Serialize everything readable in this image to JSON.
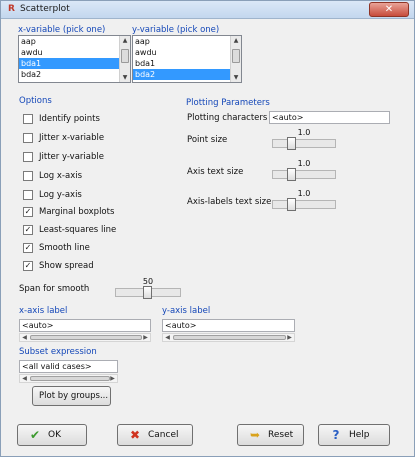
{
  "window": {
    "title": "Scatterplot",
    "app_icon": "r-icon",
    "close_glyph": "✕"
  },
  "x_variable": {
    "header": "x-variable (pick one)",
    "items": [
      "aap",
      "awdu",
      "bda1",
      "bda2"
    ],
    "selected": "bda1"
  },
  "y_variable": {
    "header": "y-variable (pick one)",
    "items": [
      "aap",
      "awdu",
      "bda1",
      "bda2"
    ],
    "selected": "bda2"
  },
  "options": {
    "header": "Options",
    "items": [
      {
        "label": "Identify points",
        "checked": false
      },
      {
        "label": "Jitter x-variable",
        "checked": false
      },
      {
        "label": "Jitter y-variable",
        "checked": false
      },
      {
        "label": "Log x-axis",
        "checked": false
      },
      {
        "label": "Log y-axis",
        "checked": false
      },
      {
        "label": "Marginal boxplots",
        "checked": true
      },
      {
        "label": "Least-squares line",
        "checked": true
      },
      {
        "label": "Smooth line",
        "checked": true
      },
      {
        "label": "Show spread",
        "checked": true
      }
    ],
    "check_glyph": "✓"
  },
  "plotting": {
    "header": "Plotting Parameters",
    "characters_label": "Plotting characters",
    "characters_value": "<auto>",
    "point_size_label": "Point size",
    "point_size": "1.0",
    "axis_text_label": "Axis text size",
    "axis_text_size": "1.0",
    "axis_labels_label": "Axis-labels text size",
    "axis_labels_size": "1.0"
  },
  "span": {
    "label": "Span for smooth",
    "value": "50"
  },
  "x_axis": {
    "label": "x-axis label",
    "value": "<auto>"
  },
  "y_axis": {
    "label": "y-axis label",
    "value": "<auto>"
  },
  "subset": {
    "label": "Subset expression",
    "value": "<all valid cases>"
  },
  "buttons": {
    "plot_by_groups": "Plot by groups...",
    "ok": "OK",
    "cancel": "Cancel",
    "reset": "Reset",
    "help": "Help"
  },
  "icons": {
    "ok": "check-icon",
    "cancel": "x-icon",
    "reset": "reset-arrow-icon",
    "help": "question-icon"
  },
  "colors": {
    "heading": "#1447b8",
    "selection": "#3399ff",
    "ok_icon": "#3c9a2e",
    "cancel_icon": "#d0331f",
    "reset_icon": "#d9a21b",
    "help_icon": "#2a5fc4"
  }
}
